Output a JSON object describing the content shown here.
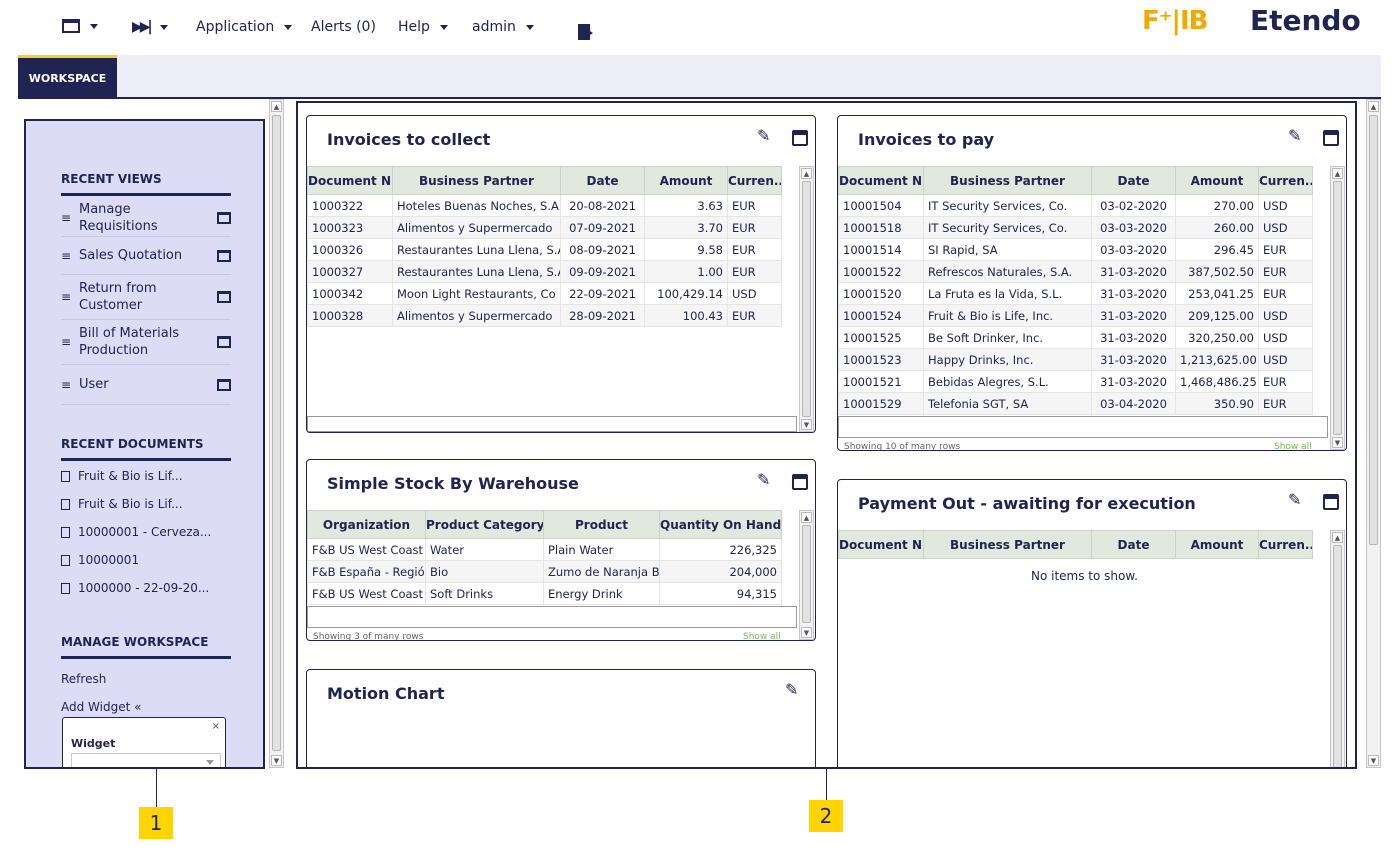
{
  "topbar": {
    "app_menu": "Application",
    "alerts": "Alerts (0)",
    "help": "Help",
    "user": "admin",
    "logo_left": "F⁺|IB",
    "logo_right": "Etendo"
  },
  "tabs": {
    "workspace": "WORKSPACE"
  },
  "left_panel": {
    "recent_views_title": "RECENT VIEWS",
    "recent_views": [
      {
        "label": "Manage Requisitions"
      },
      {
        "label": "Sales Quotation"
      },
      {
        "label": "Return from Customer"
      },
      {
        "label": "Bill of Materials Production"
      },
      {
        "label": "User"
      }
    ],
    "recent_documents_title": "RECENT DOCUMENTS",
    "recent_documents": [
      {
        "label": "Fruit & Bio is Lif..."
      },
      {
        "label": "Fruit & Bio is Lif..."
      },
      {
        "label": "10000001 - Cerveza..."
      },
      {
        "label": "10000001"
      },
      {
        "label": "1000000 - 22-09-20..."
      }
    ],
    "manage_title": "MANAGE WORKSPACE",
    "refresh": "Refresh",
    "add_widget": "Add Widget «",
    "widget_label": "Widget"
  },
  "invoices_to_collect": {
    "title": "Invoices to collect",
    "columns": [
      "Document N...",
      "Business Partner",
      "Date",
      "Amount",
      "Curren..."
    ],
    "rows": [
      [
        "1000322",
        "Hoteles Buenas Noches, S.A",
        "20-08-2021",
        "3.63",
        "EUR"
      ],
      [
        "1000323",
        "Alimentos y Supermercado",
        "07-09-2021",
        "3.70",
        "EUR"
      ],
      [
        "1000326",
        "Restaurantes Luna Llena, S.A",
        "08-09-2021",
        "9.58",
        "EUR"
      ],
      [
        "1000327",
        "Restaurantes Luna Llena, S.A",
        "09-09-2021",
        "1.00",
        "EUR"
      ],
      [
        "1000342",
        "Moon Light Restaurants, Co",
        "22-09-2021",
        "100,429.14",
        "USD"
      ],
      [
        "1000328",
        "Alimentos y Supermercado",
        "28-09-2021",
        "100.43",
        "EUR"
      ]
    ]
  },
  "invoices_to_pay": {
    "title": "Invoices to pay",
    "columns": [
      "Document N...",
      "Business Partner",
      "Date",
      "Amount",
      "Curren..."
    ],
    "rows": [
      [
        "10001504",
        "IT Security Services, Co.",
        "03-02-2020",
        "270.00",
        "USD"
      ],
      [
        "10001518",
        "IT Security Services, Co.",
        "03-03-2020",
        "260.00",
        "USD"
      ],
      [
        "10001514",
        "SI Rapid, SA",
        "03-03-2020",
        "296.45",
        "EUR"
      ],
      [
        "10001522",
        "Refrescos Naturales, S.A.",
        "31-03-2020",
        "387,502.50",
        "EUR"
      ],
      [
        "10001520",
        "La Fruta es la Vida, S.L.",
        "31-03-2020",
        "253,041.25",
        "EUR"
      ],
      [
        "10001524",
        "Fruit & Bio is Life, Inc.",
        "31-03-2020",
        "209,125.00",
        "USD"
      ],
      [
        "10001525",
        "Be Soft Drinker, Inc.",
        "31-03-2020",
        "320,250.00",
        "USD"
      ],
      [
        "10001523",
        "Happy Drinks, Inc.",
        "31-03-2020",
        "1,213,625.00",
        "USD"
      ],
      [
        "10001521",
        "Bebidas Alegres, S.L.",
        "31-03-2020",
        "1,468,486.25",
        "EUR"
      ],
      [
        "10001529",
        "Telefonia SGT, SA",
        "03-04-2020",
        "350.90",
        "EUR"
      ]
    ],
    "showing": "Showing 10 of many rows",
    "show_all": "Show all"
  },
  "stock_by_warehouse": {
    "title": "Simple Stock By Warehouse",
    "columns": [
      "Organization",
      "Product Category",
      "Product",
      "Quantity On Hand"
    ],
    "rows": [
      [
        "F&B US West Coast",
        "Water",
        "Plain Water",
        "226,325"
      ],
      [
        "F&B España - Regió",
        "Bio",
        "Zumo de Naranja B",
        "204,000"
      ],
      [
        "F&B US West Coast",
        "Soft Drinks",
        "Energy Drink",
        "94,315"
      ]
    ],
    "showing": "Showing 3 of many rows",
    "show_all": "Show all"
  },
  "payment_out": {
    "title": "Payment Out - awaiting for execution",
    "columns": [
      "Document N...",
      "Business Partner",
      "Date",
      "Amount",
      "Curren..."
    ],
    "no_items": "No items to show."
  },
  "motion_chart": {
    "title": "Motion Chart"
  },
  "callouts": {
    "left": "1",
    "main": "2"
  },
  "colors": {
    "brand": "#202452",
    "accent": "#f2cf26",
    "logo": "#f2a900",
    "panel": "#dcdcf7",
    "header": "#e1e9df"
  }
}
